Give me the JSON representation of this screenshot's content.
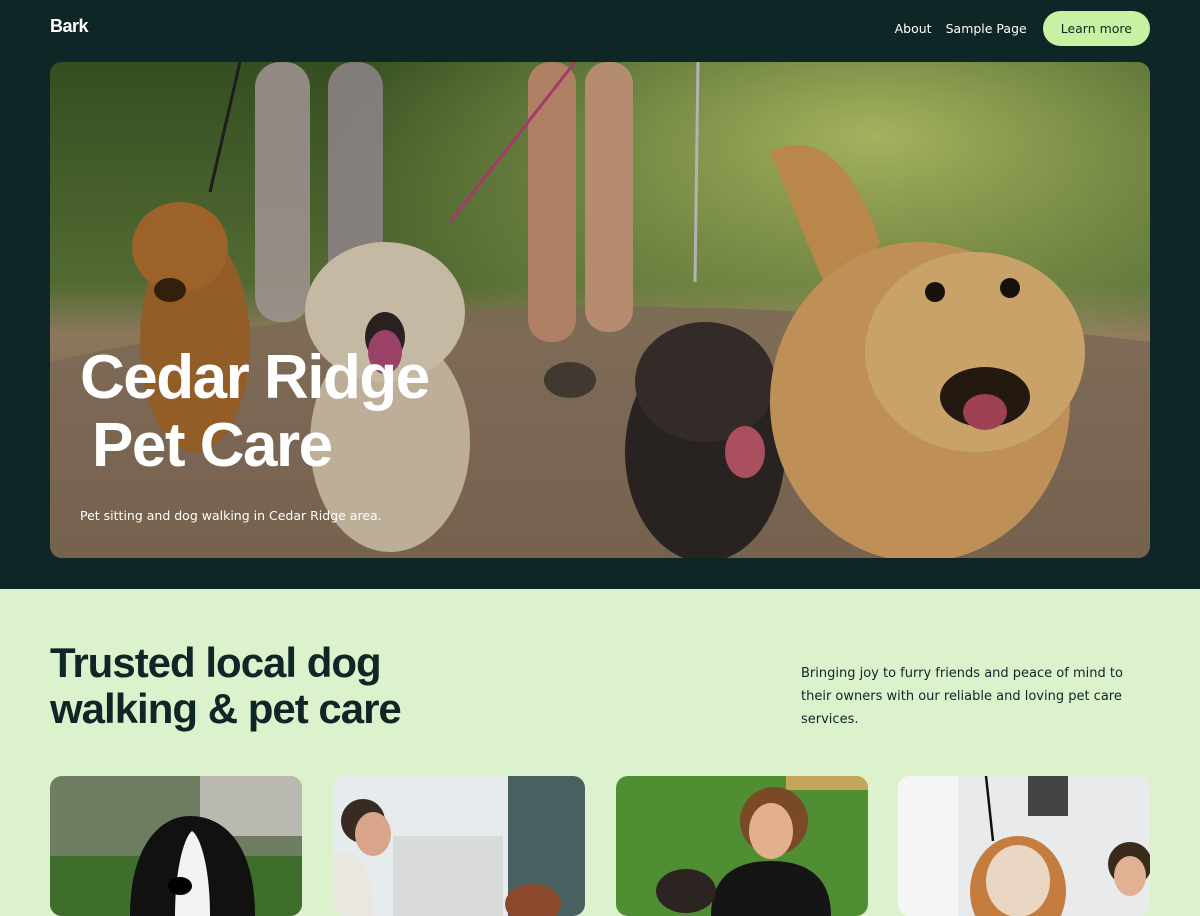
{
  "brand": "Bark",
  "nav": {
    "items": [
      "About",
      "Sample Page"
    ],
    "cta": "Learn more"
  },
  "hero": {
    "title_line1": "Cedar Ridge",
    "title_line2": "Pet Care",
    "subtitle": "Pet sitting and dog walking in Cedar Ridge area."
  },
  "intro": {
    "title": "Trusted local dog walking & pet care",
    "text": "Bringing joy to furry friends and peace of mind to their owners with our reliable and loving pet care services."
  },
  "colors": {
    "dark_green": "#0f2626",
    "mint_bg": "#dcf2cc",
    "cta_green": "#c8f2a2"
  }
}
